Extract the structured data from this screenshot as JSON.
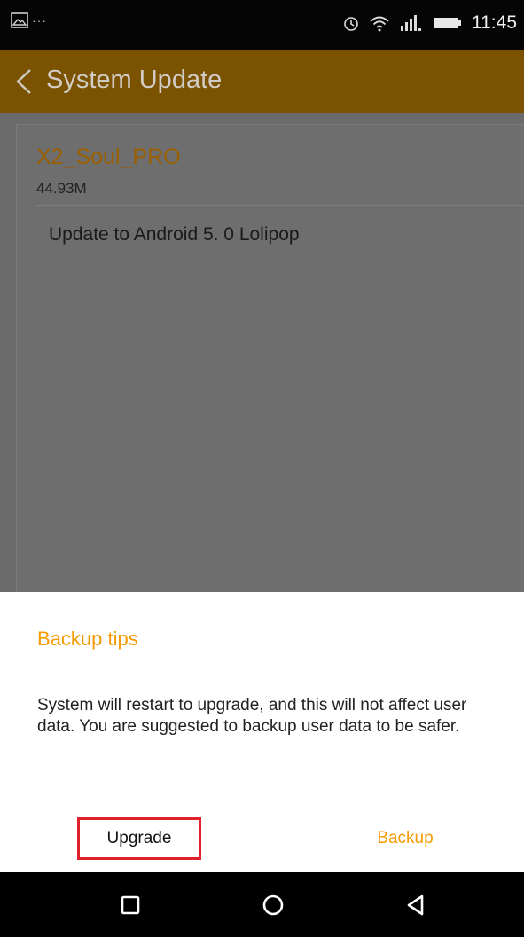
{
  "status_bar": {
    "time": "11:45",
    "left_dots": "···",
    "icons": [
      "gallery-notification-icon",
      "alarm-icon",
      "wifi-icon",
      "signal-icon",
      "battery-icon"
    ]
  },
  "app_bar": {
    "title": "System Update",
    "background_color": "#7a5200"
  },
  "update_package": {
    "name": "X2_Soul_PRO",
    "size": "44.93M",
    "description": "Update to Android 5. 0 Lolipop"
  },
  "dialog": {
    "title": "Backup tips",
    "message": "System will restart to upgrade, and this will not affect user data. You are suggested to backup user data to be safer.",
    "upgrade_label": "Upgrade",
    "backup_label": "Backup",
    "accent_color": "#f59a00",
    "highlight_color": "#e0202c"
  },
  "nav_bar": {
    "icons": [
      "recent-apps-icon",
      "home-icon",
      "back-icon"
    ]
  }
}
